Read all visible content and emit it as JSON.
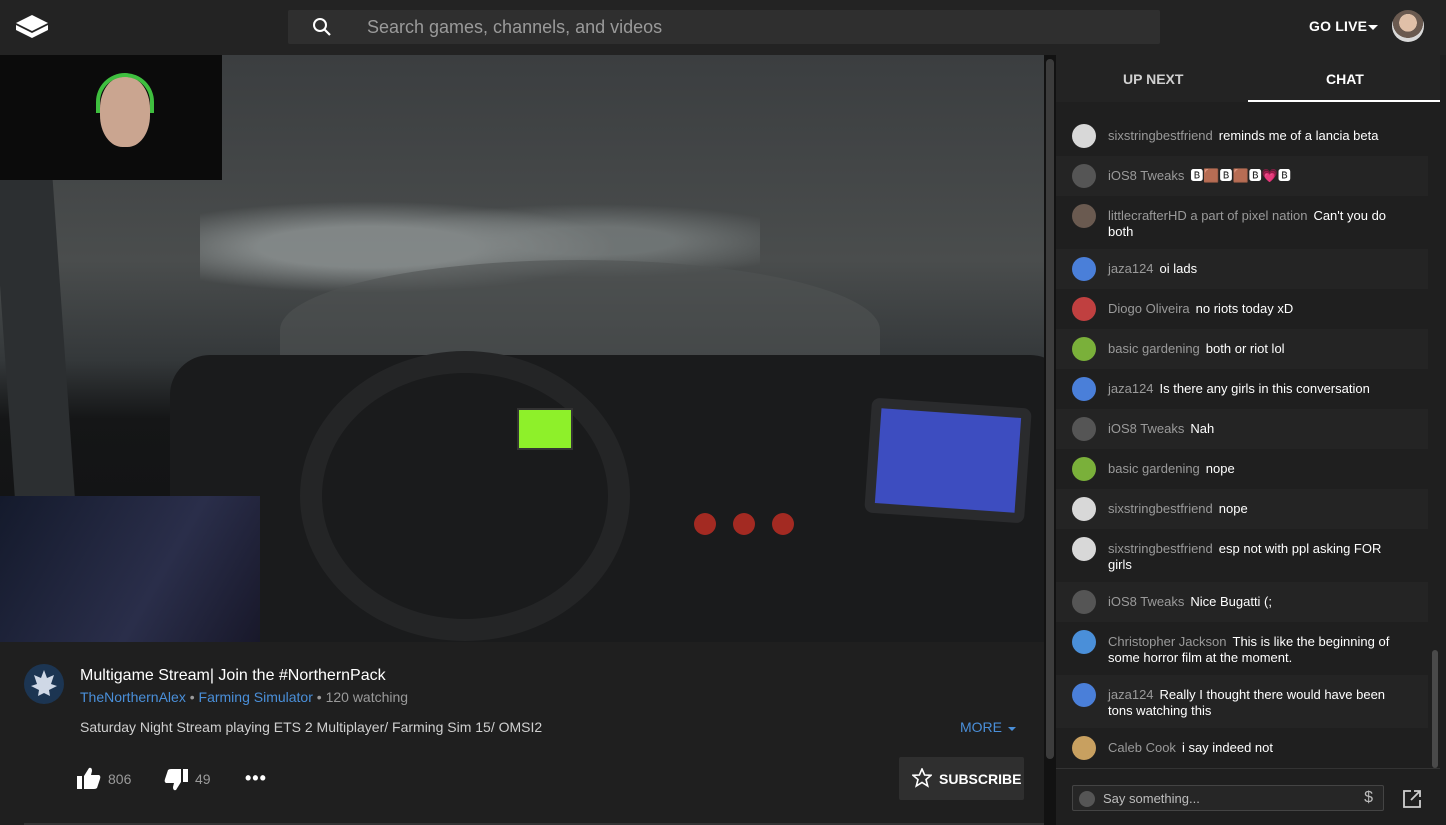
{
  "header": {
    "search_placeholder": "Search games, channels, and videos",
    "go_live_label": "GO LIVE"
  },
  "video": {
    "title": "Multigame Stream| Join the #NorthernPack",
    "channel": "TheNorthernAlex",
    "separator1": " • ",
    "game": "Farming Simulator",
    "watching": " • 120 watching",
    "description": "Saturday Night Stream playing ETS 2 Multiplayer/ Farming Sim 15/ OMSI2",
    "more_label": "MORE",
    "likes": "806",
    "dislikes": "49",
    "subscribe_label": "SUBSCRIBE"
  },
  "tabs": {
    "up_next": "UP NEXT",
    "chat": "CHAT"
  },
  "chat": {
    "messages": [
      {
        "name": "sixstringbestfriend",
        "text": "reminds me of a lancia beta",
        "avatar_color": "#d8d8d8"
      },
      {
        "name": "iOS8 Tweaks",
        "text": "🅱🟫🅱🟫🅱💗🅱",
        "avatar_color": "#555555"
      },
      {
        "name": "littlecrafterHD a part of pixel nation",
        "text": "Can't you do both",
        "avatar_color": "#6a5a50"
      },
      {
        "name": "jaza124",
        "text": "oi lads",
        "avatar_color": "#4a7fd9"
      },
      {
        "name": "Diogo Oliveira",
        "text": "no riots today xD",
        "avatar_color": "#c04040"
      },
      {
        "name": "basic gardening",
        "text": "both or riot lol",
        "avatar_color": "#7ab03a"
      },
      {
        "name": "jaza124",
        "text": "Is there any girls in this conversation",
        "avatar_color": "#4a7fd9"
      },
      {
        "name": "iOS8 Tweaks",
        "text": "Nah",
        "avatar_color": "#555555"
      },
      {
        "name": "basic gardening",
        "text": "nope",
        "avatar_color": "#7ab03a"
      },
      {
        "name": "sixstringbestfriend",
        "text": "nope",
        "avatar_color": "#d8d8d8"
      },
      {
        "name": "sixstringbestfriend",
        "text": "esp not with ppl asking FOR girls",
        "avatar_color": "#d8d8d8"
      },
      {
        "name": "iOS8 Tweaks",
        "text": "Nice Bugatti (;",
        "avatar_color": "#555555"
      },
      {
        "name": "Christopher Jackson",
        "text": "This is like the beginning of some horror film at the moment.",
        "avatar_color": "#4a8fd9"
      },
      {
        "name": "jaza124",
        "text": "Really I thought there would have been tons watching this",
        "avatar_color": "#4a7fd9"
      },
      {
        "name": "Caleb Cook",
        "text": "i say indeed not",
        "avatar_color": "#c8a060"
      }
    ],
    "input_placeholder": "Say something...",
    "super_chat_symbol": "$"
  },
  "colors": {
    "link": "#4a8fd9",
    "background": "#1f1f1f",
    "header": "#232323"
  },
  "icons": [
    "youtube-gaming-logo",
    "search-icon",
    "caret-down-icon",
    "thumb-up-icon",
    "thumb-down-icon",
    "more-horiz-icon",
    "star-icon",
    "emoji-icon",
    "dollar-icon",
    "popout-icon"
  ]
}
